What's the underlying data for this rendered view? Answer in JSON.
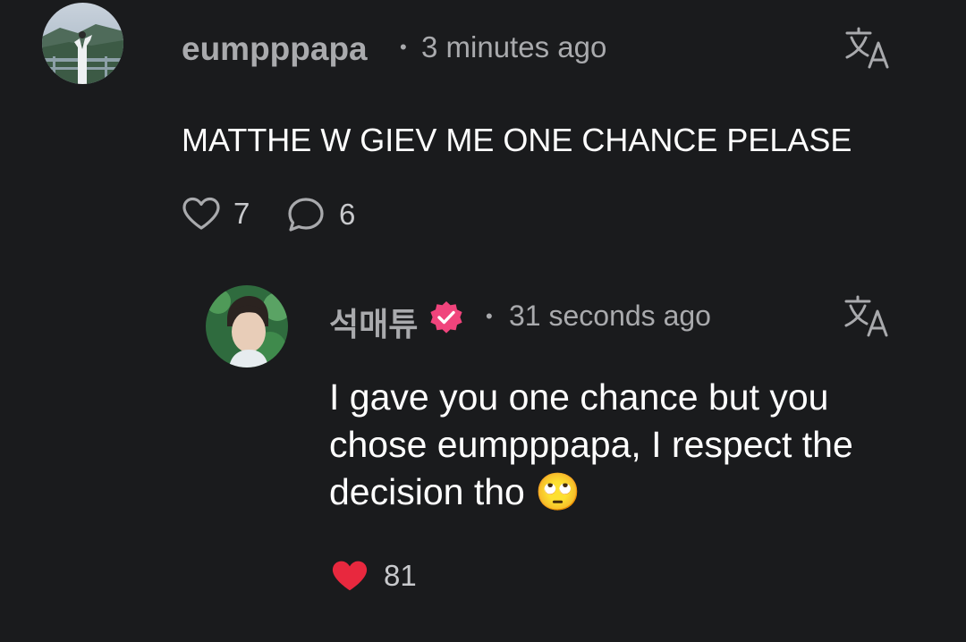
{
  "comments": [
    {
      "username": "eumpppapa",
      "dot": "•",
      "timestamp": "3 minutes ago",
      "text": "MATTHE W GIEV ME ONE CHANCE PELASE",
      "likes": "7",
      "replies": "6",
      "liked": false
    },
    {
      "username": "석매튜",
      "verified": true,
      "dot": "•",
      "timestamp": "31 seconds ago",
      "text_lines": [
        "I gave you one chance but you",
        "chose eumpppapa, I respect the",
        "decision tho"
      ],
      "emoji": "🙄",
      "likes": "81",
      "liked": true
    }
  ],
  "icons": {
    "translate": "translate-icon",
    "heart": "heart-icon",
    "comment": "comment-bubble-icon",
    "verified": "verified-badge-icon"
  },
  "colors": {
    "background": "#1a1b1d",
    "text_primary": "#ffffff",
    "text_secondary": "#a9aaad",
    "liked_heart": "#e8283e",
    "verified_badge": "#f0447c"
  }
}
